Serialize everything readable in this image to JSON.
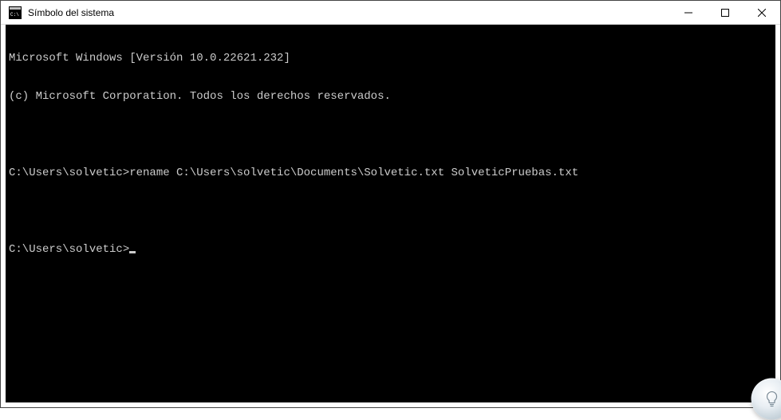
{
  "window": {
    "title": "Símbolo del sistema"
  },
  "terminal": {
    "lines": [
      "Microsoft Windows [Versión 10.0.22621.232]",
      "(c) Microsoft Corporation. Todos los derechos reservados.",
      "",
      "C:\\Users\\solvetic>rename C:\\Users\\solvetic\\Documents\\Solvetic.txt SolveticPruebas.txt",
      "",
      "C:\\Users\\solvetic>"
    ],
    "prompt": "C:\\Users\\solvetic>",
    "last_command": "rename C:\\Users\\solvetic\\Documents\\Solvetic.txt SolveticPruebas.txt"
  },
  "controls": {
    "minimize": "Minimize",
    "maximize": "Maximize",
    "close": "Close"
  }
}
